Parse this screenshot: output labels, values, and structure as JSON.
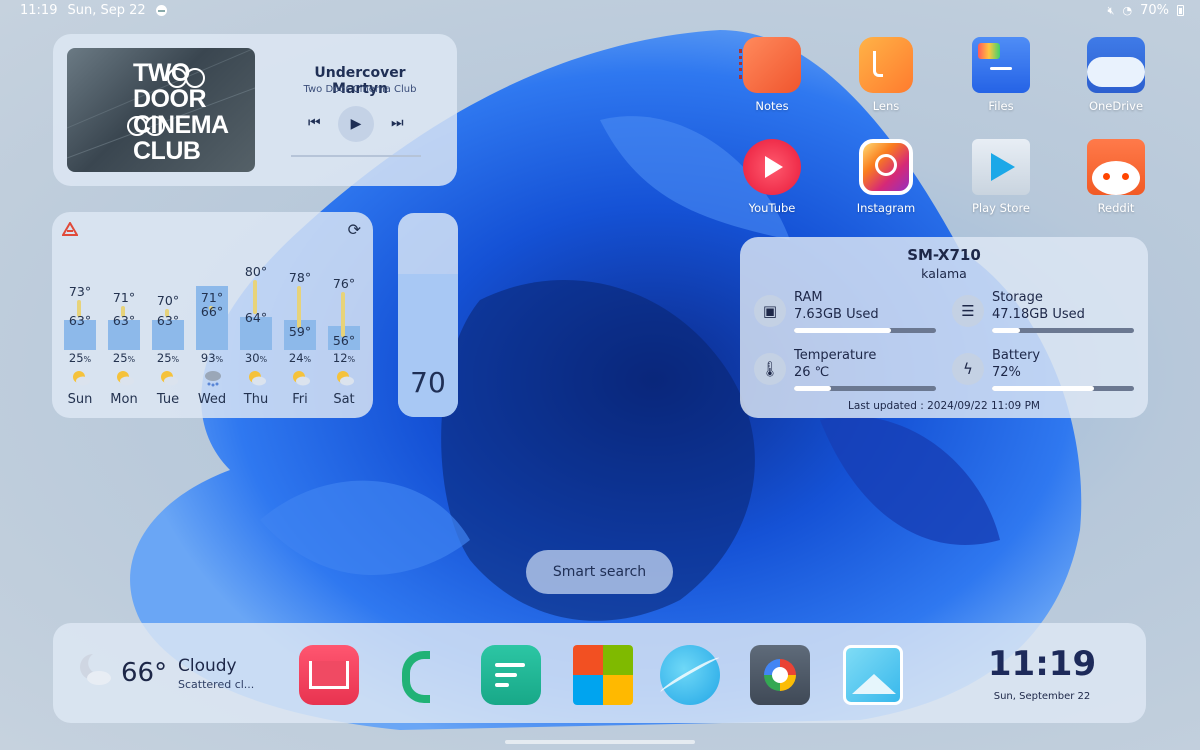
{
  "status_bar": {
    "time": "11:19",
    "date": "Sun, Sep 22",
    "battery": "70%"
  },
  "music": {
    "album_art_text": "TWO DOOR CINEMA CLUB",
    "title": "Undercover Martyn",
    "artist": "Two Door Cinema Club"
  },
  "apps": [
    {
      "label": "Notes",
      "icon": "notes-icon"
    },
    {
      "label": "Lens",
      "icon": "lens-icon"
    },
    {
      "label": "Files",
      "icon": "files-icon"
    },
    {
      "label": "OneDrive",
      "icon": "onedrive-icon"
    },
    {
      "label": "YouTube",
      "icon": "youtube-icon"
    },
    {
      "label": "Instagram",
      "icon": "instagram-icon"
    },
    {
      "label": "Play Store",
      "icon": "play-store-icon"
    },
    {
      "label": "Reddit",
      "icon": "reddit-icon"
    }
  ],
  "weather": {
    "days": [
      {
        "day": "Sun",
        "high": "73°",
        "low": "63°",
        "precip": "25",
        "icon": "partly-cloudy-icon"
      },
      {
        "day": "Mon",
        "high": "71°",
        "low": "63°",
        "precip": "25",
        "icon": "partly-cloudy-icon"
      },
      {
        "day": "Tue",
        "high": "70°",
        "low": "63°",
        "precip": "25",
        "icon": "partly-cloudy-icon"
      },
      {
        "day": "Wed",
        "high": "71°",
        "low": "66°",
        "precip": "93",
        "icon": "rain-icon"
      },
      {
        "day": "Thu",
        "high": "80°",
        "low": "64°",
        "precip": "30",
        "icon": "partly-cloudy-icon"
      },
      {
        "day": "Fri",
        "high": "78°",
        "low": "59°",
        "precip": "24",
        "icon": "partly-cloudy-icon"
      },
      {
        "day": "Sat",
        "high": "76°",
        "low": "56°",
        "precip": "12",
        "icon": "partly-cloudy-icon"
      }
    ],
    "percent_sign": "%"
  },
  "battery_slider": {
    "value": "70",
    "level": 0.7
  },
  "device": {
    "model": "SM-X710",
    "codename": "kalama",
    "ram": {
      "label": "RAM",
      "value": "7.63GB Used",
      "fraction": 0.68
    },
    "storage": {
      "label": "Storage",
      "value": "47.18GB Used",
      "fraction": 0.2
    },
    "temperature": {
      "label": "Temperature",
      "value": "26 ℃",
      "fraction": 0.26
    },
    "battery": {
      "label": "Battery",
      "value": "72%",
      "fraction": 0.72
    },
    "updated": "Last updated : 2024/09/22 11:09 PM"
  },
  "search": {
    "label": "Smart search"
  },
  "dock": {
    "temp": "66°",
    "condition": "Cloudy",
    "description": "Scattered cl...",
    "apps": [
      "gmail-icon",
      "phone-icon",
      "docs-icon",
      "microsoft-icon",
      "browser-icon",
      "camera-icon",
      "gallery-icon"
    ],
    "time": "11:19",
    "date": "Sun, September 22"
  }
}
